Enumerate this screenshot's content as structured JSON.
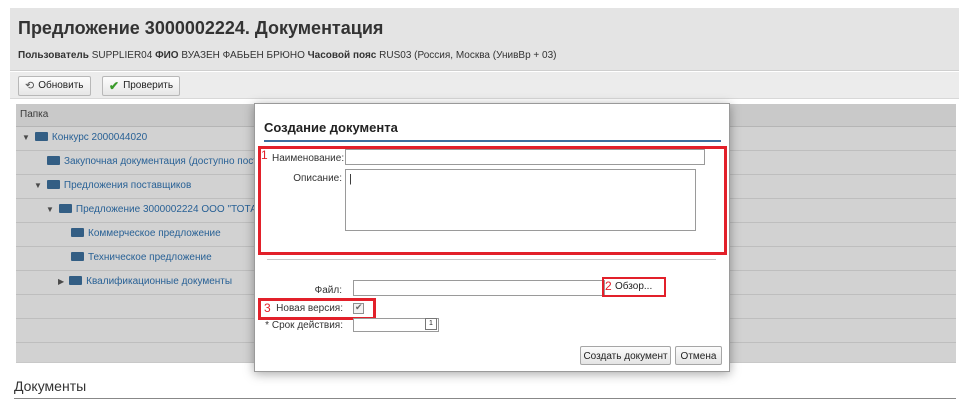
{
  "page": {
    "title": "Предложение 3000002224. Документация",
    "user_label": "Пользователь",
    "user_value": "SUPPLIER04",
    "fio_label": "ФИО",
    "fio_value": "ВУАЗЕН ФАБЬЕН БРЮНО",
    "tz_label": "Часовой пояс",
    "tz_value": "RUS03 (Россия, Москва (УнивВр + 03)"
  },
  "toolbar": {
    "refresh_label": "Обновить",
    "check_label": "Проверить"
  },
  "tree": {
    "column_header": "Папка",
    "rows": [
      {
        "label": "Конкурс 2000044020"
      },
      {
        "label": "Закупочная документация (доступно постав"
      },
      {
        "label": "Предложения поставщиков"
      },
      {
        "label": "Предложение 3000002224 ООО \"ТОТАЛ"
      },
      {
        "label": "Коммерческое предложение"
      },
      {
        "label": "Техническое предложение"
      },
      {
        "label": "Квалификационные документы"
      }
    ]
  },
  "documents": {
    "title": "Документы"
  },
  "dialog": {
    "title": "Создание документа",
    "name_label": "Наименование:",
    "name_value": "",
    "description_label": "Описание:",
    "description_value": "|",
    "file_label": "Файл:",
    "file_value": "",
    "browse_label": "Обзор...",
    "new_version_label": "Новая версия:",
    "validity_label": "* Срок действия:",
    "validity_value": "",
    "calendar_glyph": "1",
    "create_label": "Создать документ",
    "cancel_label": "Отмена",
    "markers": [
      "1",
      "2",
      "3"
    ],
    "new_version_checked": true
  },
  "colors": {
    "highlight": "#e2202a",
    "link": "#1c5d99",
    "accent_line": "#3d6e9e"
  }
}
